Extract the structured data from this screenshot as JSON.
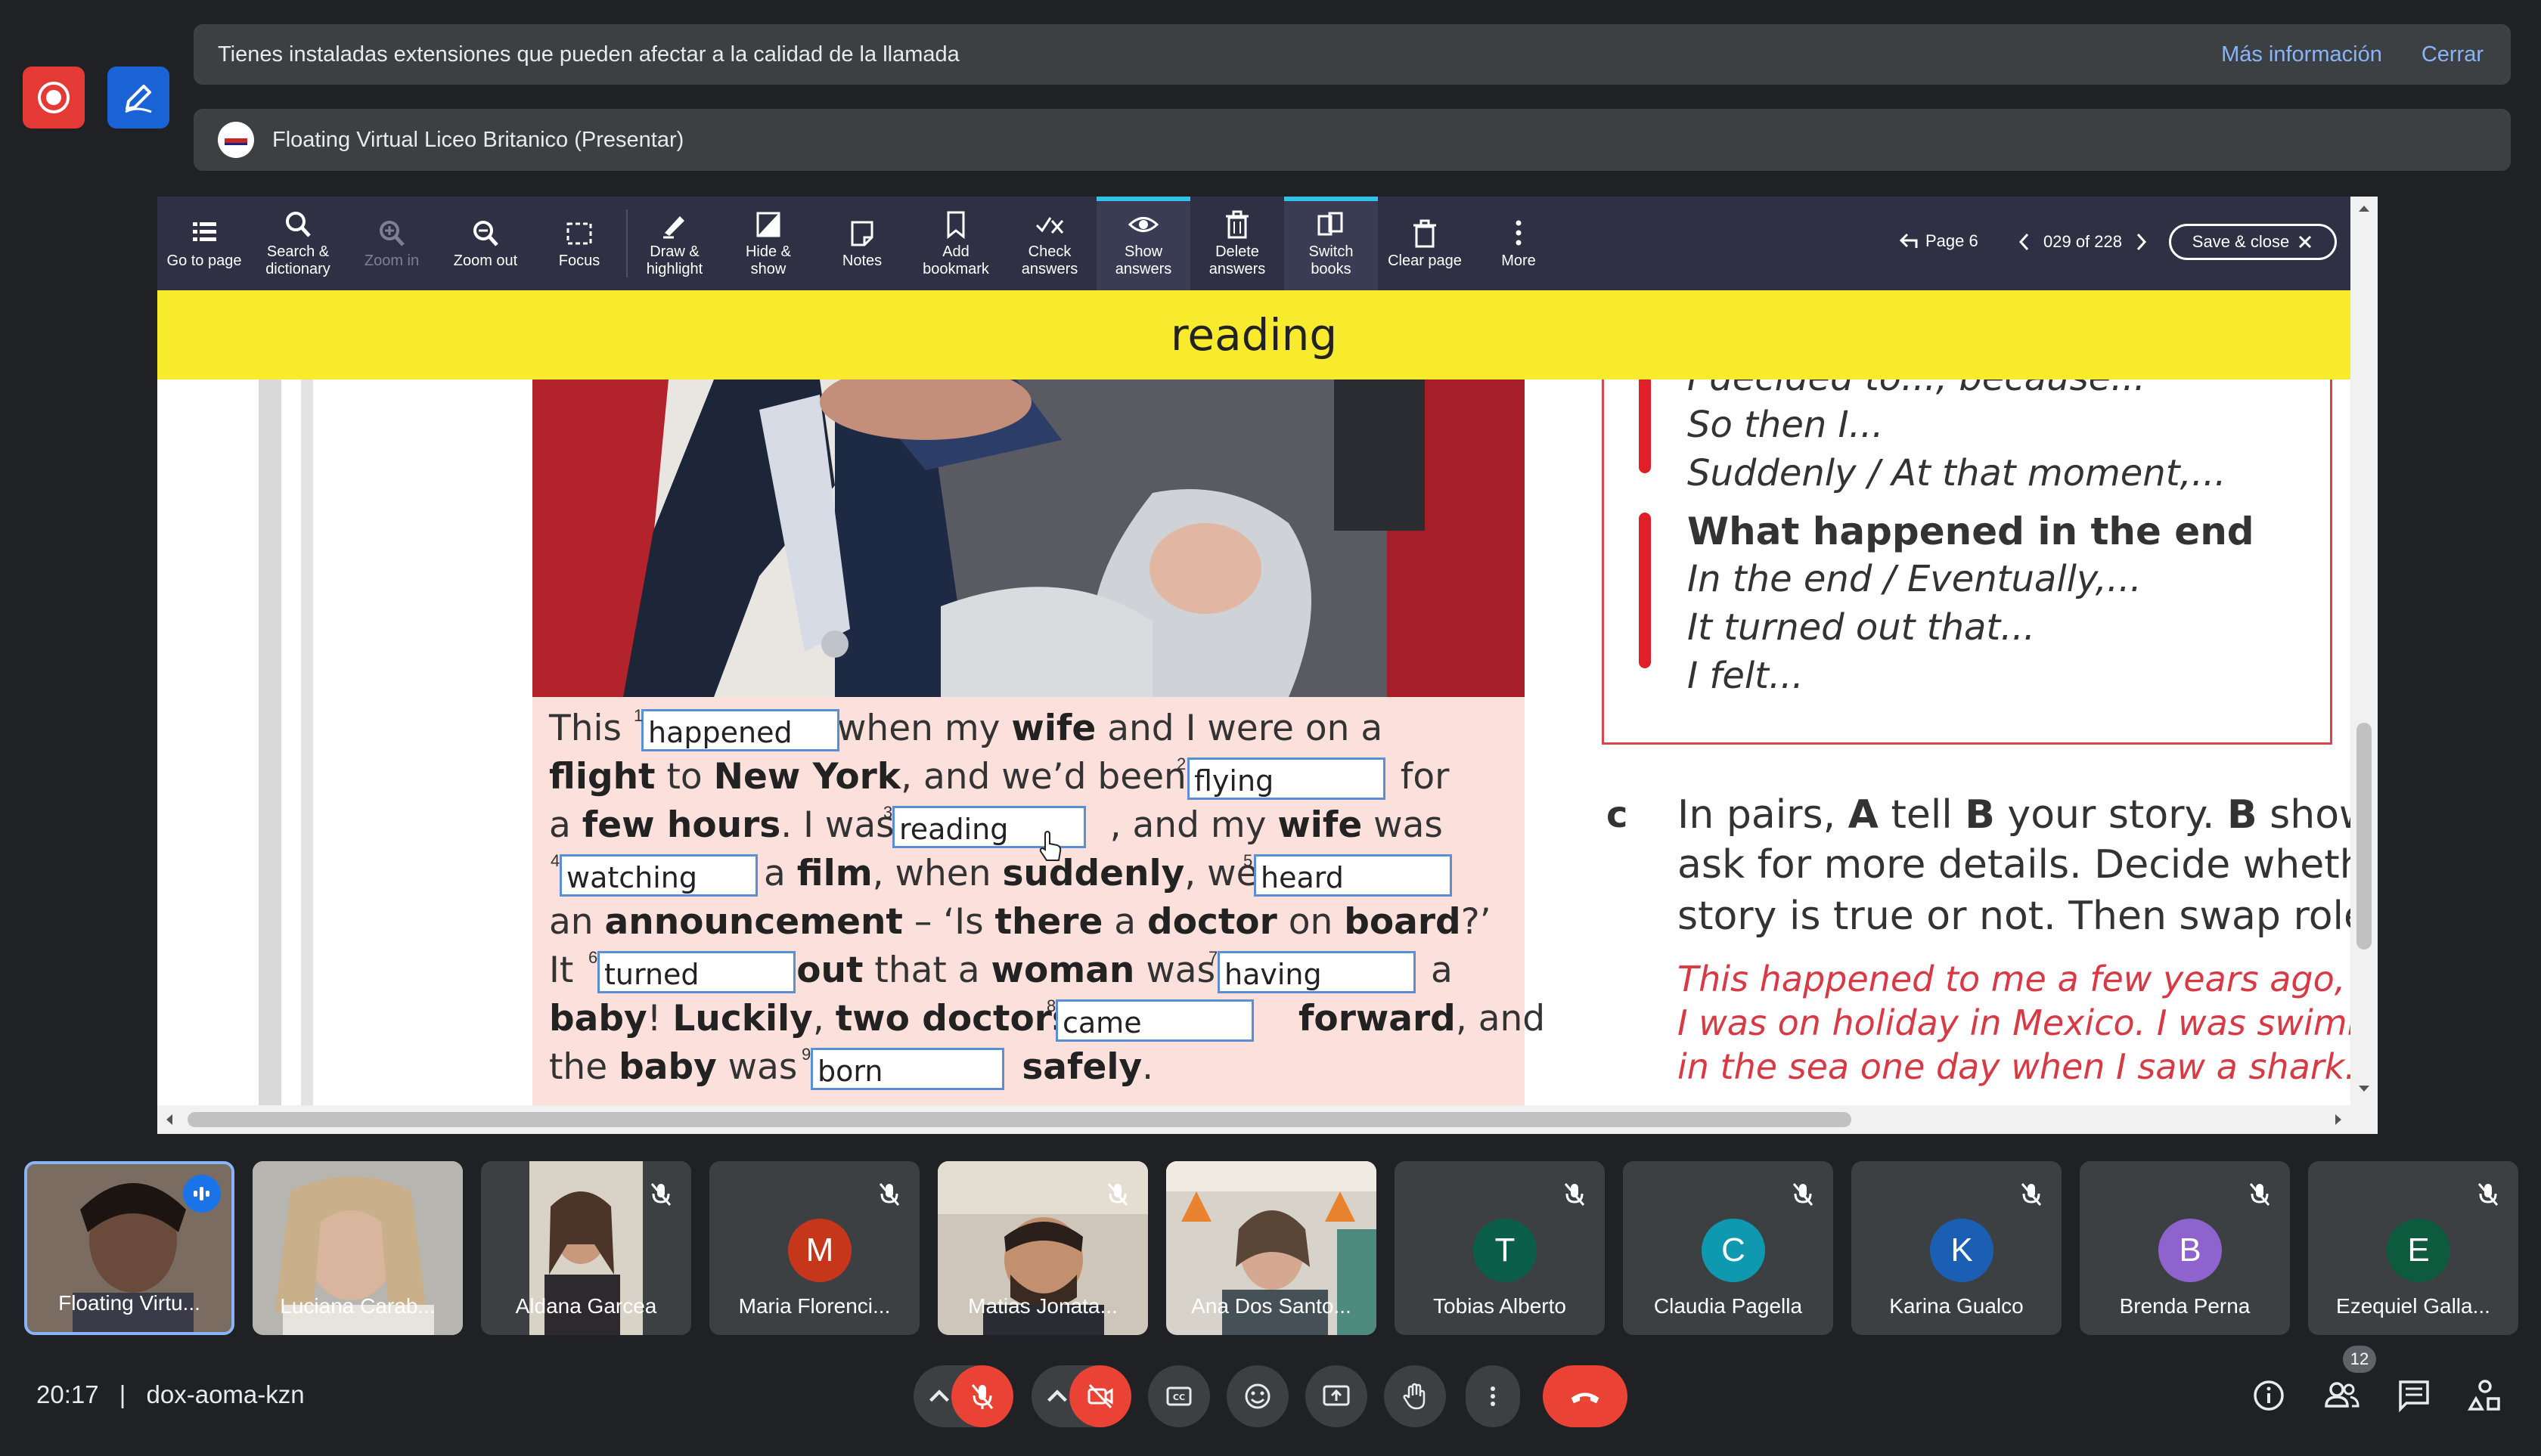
{
  "banners": {
    "extensions": {
      "text": "Tienes instaladas extensiones que pueden afectar a la calidad de la llamada",
      "more_info": "Más información",
      "close": "Cerrar"
    },
    "presenting": "Floating Virtual Liceo Britanico (Presentar)"
  },
  "toolbar": {
    "items": [
      {
        "label1": "Go to page",
        "label2": "",
        "icon": "list-icon"
      },
      {
        "label1": "Search &",
        "label2": "dictionary",
        "icon": "search-icon"
      },
      {
        "label1": "Zoom in",
        "label2": "",
        "icon": "zoom-in-icon"
      },
      {
        "label1": "Zoom out",
        "label2": "",
        "icon": "zoom-out-icon"
      },
      {
        "label1": "Focus",
        "label2": "",
        "icon": "focus-icon"
      },
      {
        "label1": "Draw &",
        "label2": "highlight",
        "icon": "pen-icon"
      },
      {
        "label1": "Hide &",
        "label2": "show",
        "icon": "hide-icon"
      },
      {
        "label1": "Notes",
        "label2": "",
        "icon": "note-icon"
      },
      {
        "label1": "Add",
        "label2": "bookmark",
        "icon": "bookmark-icon"
      },
      {
        "label1": "Check",
        "label2": "answers",
        "icon": "check-icon"
      },
      {
        "label1": "Show",
        "label2": "answers",
        "icon": "eye-icon"
      },
      {
        "label1": "Delete",
        "label2": "answers",
        "icon": "trash-icon"
      },
      {
        "label1": "Switch",
        "label2": "books",
        "icon": "books-icon"
      },
      {
        "label1": "Clear page",
        "label2": "",
        "icon": "trash-icon"
      },
      {
        "label1": "More",
        "label2": "",
        "icon": "more-icon"
      }
    ],
    "page_back": "Page 6",
    "page_counter": "029 of 228",
    "save_close": "Save & close"
  },
  "yellow_word": "reading",
  "story": {
    "l1a": "This ",
    "l1b": "when my ",
    "l1c": "wife",
    "l1d": " and I were on a",
    "l2a": "flight",
    "l2b": " to ",
    "l2c": "New York",
    "l2d": ", and we’d been ",
    "l2e": "for",
    "l3a": "a ",
    "l3b": "few hours",
    "l3c": ". I was ",
    "l3d": ", and my ",
    "l3e": "wife",
    "l3f": " was",
    "l4a": "a ",
    "l4b": "film",
    "l4c": ", when ",
    "l4d": "suddenly",
    "l4e": ", we ",
    "l5a": "an ",
    "l5b": "announcement",
    "l5c": " – ‘Is ",
    "l5d": "there",
    "l5e": " a ",
    "l5f": "doctor",
    "l5g": " on ",
    "l5h": "board",
    "l5i": "?’",
    "l6a": "It ",
    "l6b": "out",
    "l6c": " that a ",
    "l6d": "woman",
    "l6e": " was ",
    "l6f": "a",
    "l7a": "baby",
    "l7b": "! ",
    "l7c": "Luckily",
    "l7d": ", ",
    "l7e": "two doctors",
    "l7f": "forward",
    "l7g": ", and",
    "l8a": "the ",
    "l8b": "baby",
    "l8c": " was ",
    "l8d": "safely",
    "l8e": ".",
    "answers": [
      "happened",
      "flying",
      "reading",
      "watching",
      "heard",
      "turned",
      "having",
      "came",
      "born"
    ],
    "nums": [
      "1",
      "2",
      "3",
      "4",
      "5",
      "6",
      "7",
      "8",
      "9"
    ]
  },
  "right_box": {
    "line0": "I decided to..., because...",
    "line1": "So then I...",
    "line2": "Suddenly / At that moment,...",
    "heading": "What happened in the end",
    "line3": "In the end / Eventually,...",
    "line4": "It turned out that...",
    "line5": "I felt..."
  },
  "exercise_c": {
    "letter": "c",
    "line1a": "In pairs, ",
    "line1b": "A",
    "line1c": " tell ",
    "line1d": "B",
    "line1e": " your story. ",
    "line1f": "B",
    "line1g": " show",
    "line2": "ask for more details. Decide wheth",
    "line3": "story is true or not. Then swap role",
    "red1": "This happened to me a few years ago, w",
    "red2": "I was on holiday in Mexico. I was swimm",
    "red3": "in the sea one day when I saw a shark."
  },
  "participants": [
    {
      "name": "Floating Virtu...",
      "type": "video",
      "speaking": true
    },
    {
      "name": "Luciana Carab...",
      "type": "video"
    },
    {
      "name": "Aldana Garcea",
      "type": "video"
    },
    {
      "name": "Maria Florenci...",
      "initial": "M",
      "color": "#c5361b"
    },
    {
      "name": "Matias Jonata...",
      "type": "video"
    },
    {
      "name": "Ana Dos Santo...",
      "type": "video"
    },
    {
      "name": "Tobias Alberto",
      "initial": "T",
      "color": "#0b5e49"
    },
    {
      "name": "Claudia Pagella",
      "initial": "C",
      "color": "#0f99b0"
    },
    {
      "name": "Karina Gualco",
      "initial": "K",
      "color": "#1a5fb4"
    },
    {
      "name": "Brenda Perna",
      "initial": "B",
      "color": "#8e63ce"
    },
    {
      "name": "Ezequiel Galla...",
      "initial": "E",
      "color": "#0d5a3e"
    }
  ],
  "footer": {
    "time": "20:17",
    "separator": "|",
    "meeting_code": "dox-aoma-kzn",
    "people_count": "12"
  },
  "colors": {
    "background": "#202124",
    "tile": "#3c4043",
    "danger": "#ea4335",
    "toolbar": "#2f3043",
    "highlight": "#f8ea2c"
  }
}
